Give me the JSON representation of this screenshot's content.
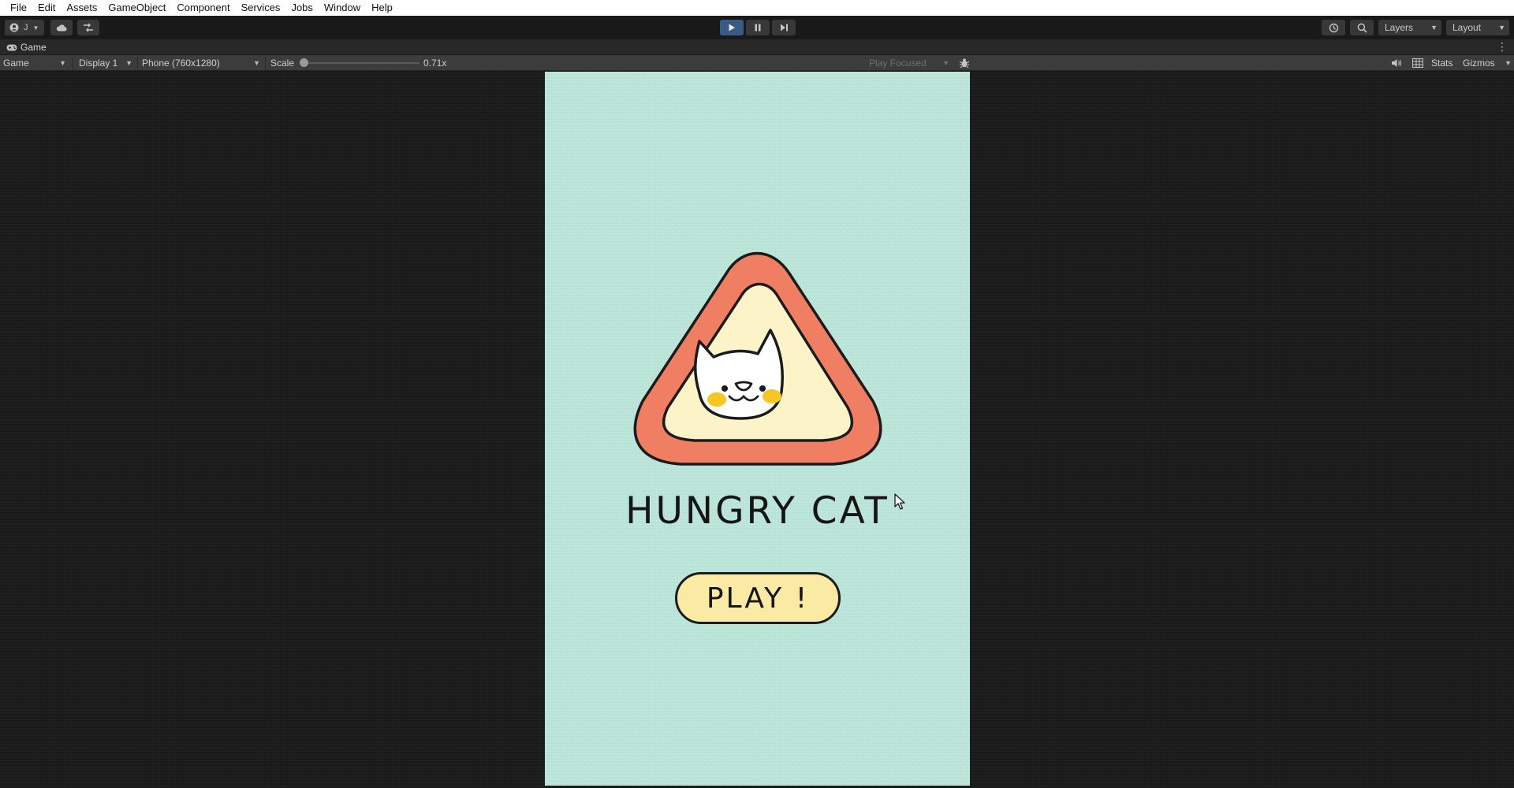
{
  "menubar": {
    "items": [
      "File",
      "Edit",
      "Assets",
      "GameObject",
      "Component",
      "Services",
      "Jobs",
      "Window",
      "Help"
    ]
  },
  "toolbar": {
    "account_label": "J",
    "cloud_icon": "cloud-icon",
    "collab_icon": "collab-icon",
    "play_icon": "play-icon",
    "pause_icon": "pause-icon",
    "step_icon": "step-icon",
    "history_icon": "history-icon",
    "search_icon": "search-icon",
    "layers_label": "Layers",
    "layout_label": "Layout",
    "accent_color": "#3a5a86"
  },
  "tab": {
    "title": "Game"
  },
  "gamebar": {
    "view_select": "Game",
    "display_select": "Display 1",
    "resolution_select": "Phone (760x1280)",
    "scale_label": "Scale",
    "scale_value": "0.71x",
    "play_mode_select": "Play Focused",
    "stats_label": "Stats",
    "gizmos_label": "Gizmos"
  },
  "game": {
    "title": "HUNGRY CAT",
    "play_button": "PLAY !",
    "background_color": "#b8e3d6",
    "triangle_outer_color": "#f07e63",
    "triangle_inner_color": "#fdf3c9",
    "button_color": "#fbeaa3",
    "cheek_color": "#f6c623"
  }
}
